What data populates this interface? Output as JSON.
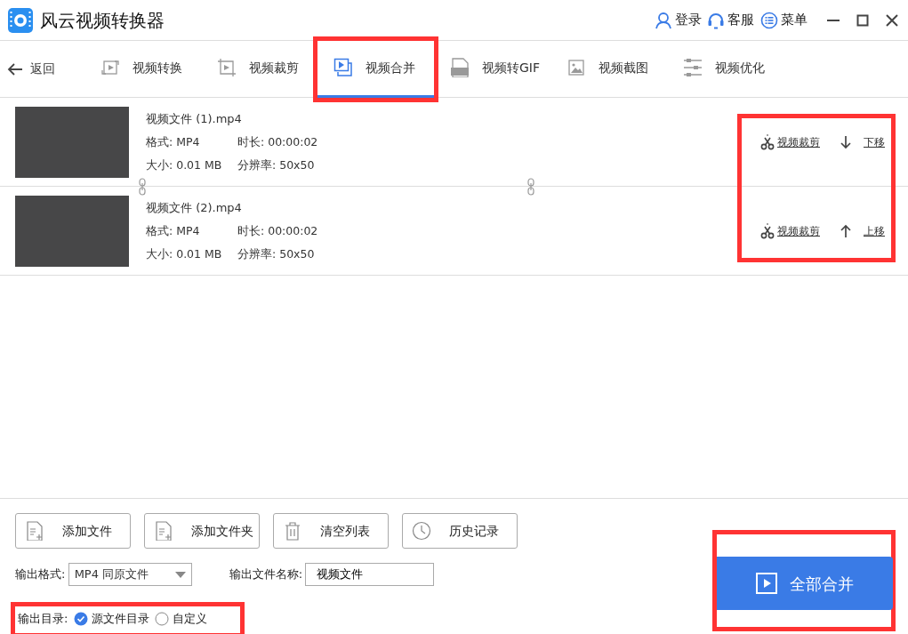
{
  "window": {
    "title": "风云视频转换器"
  },
  "header_links": [
    {
      "label": "登录"
    },
    {
      "label": "客服"
    },
    {
      "label": "菜单"
    }
  ],
  "nav": {
    "back": "返回",
    "tabs": [
      {
        "label": "视频转换",
        "selected": false,
        "highlighted": false
      },
      {
        "label": "视频裁剪",
        "selected": false,
        "highlighted": false
      },
      {
        "label": "视频合并",
        "selected": true,
        "highlighted": true
      },
      {
        "label": "视频转GIF",
        "selected": false,
        "highlighted": false
      },
      {
        "label": "视频截图",
        "selected": false,
        "highlighted": false
      },
      {
        "label": "视频优化",
        "selected": false,
        "highlighted": false
      }
    ]
  },
  "files": {
    "actions_highlighted": true,
    "items": [
      {
        "name": "视频文件 (1).mp4",
        "format": "格式: MP4",
        "duration": "时长: 00:00:02",
        "size": "大小: 0.01 MB",
        "resolution": "分辨率: 50x50",
        "trim": "视频裁剪",
        "move": {
          "label": "下移",
          "upward": false
        }
      },
      {
        "name": "视频文件 (2).mp4",
        "format": "格式: MP4",
        "duration": "时长: 00:00:02",
        "size": "大小: 0.01 MB",
        "resolution": "分辨率: 50x50",
        "trim": "视频裁剪",
        "move": {
          "label": "上移",
          "upward": true
        }
      }
    ]
  },
  "toolbar": [
    {
      "label": "添加文件"
    },
    {
      "label": "添加文件夹"
    },
    {
      "label": "清空列表"
    },
    {
      "label": "历史记录"
    }
  ],
  "output": {
    "format_label": "输出格式:",
    "format_value": "MP4 同原文件",
    "name_label": "输出文件名称:",
    "name_value": "视频文件",
    "dir": {
      "label": "输出目录:",
      "highlighted": true,
      "options": [
        {
          "label": "源文件目录",
          "selected": true
        },
        {
          "label": "自定义",
          "selected": false
        }
      ]
    }
  },
  "merge_button": {
    "label": "全部合并",
    "highlighted": true
  }
}
